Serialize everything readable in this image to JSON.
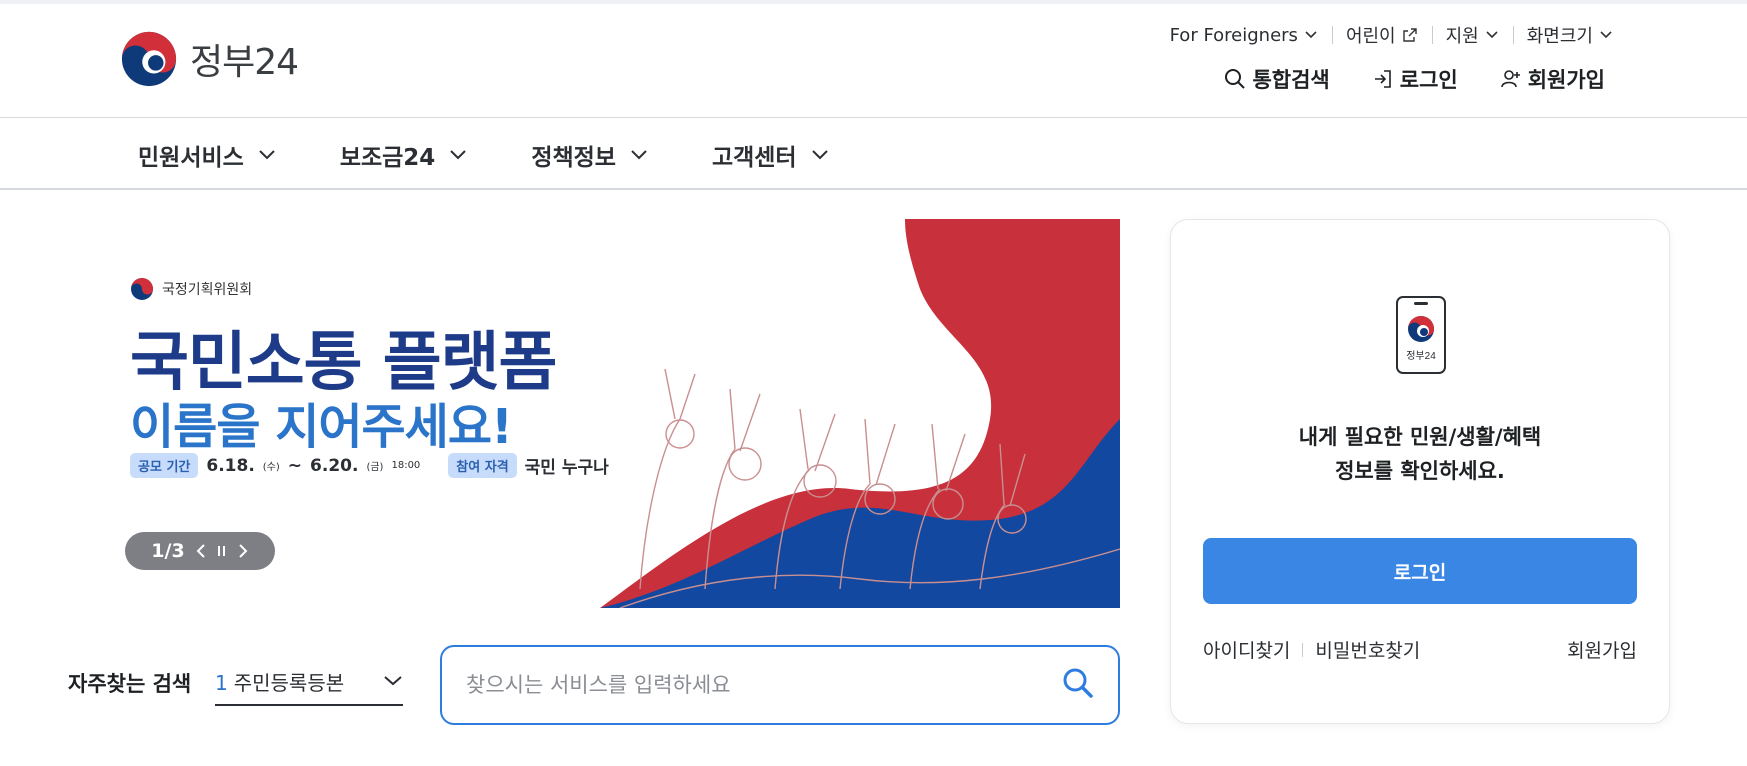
{
  "header": {
    "brand": "정부24",
    "utility": [
      "For Foreigners",
      "어린이",
      "지원",
      "화면크기"
    ],
    "actions": {
      "search": "통합검색",
      "login": "로그인",
      "signup": "회원가입"
    }
  },
  "nav": [
    "민원서비스",
    "보조금24",
    "정책정보",
    "고객센터"
  ],
  "banner": {
    "org": "국정기획위원회",
    "title1": "국민소통 플랫폼",
    "title2": "이름을 지어주세요!",
    "period_label": "공모 기간",
    "start": "6.18.",
    "start_day": "(수)",
    "tilde": "~",
    "end": "6.20.",
    "end_day": "(금)",
    "end_time": "18:00",
    "eligibility_label": "참여 자격",
    "eligibility": "국민 누구나",
    "slide_indicator": "1/3"
  },
  "search": {
    "fav_label": "자주찾는 검색",
    "fav_index": "1",
    "fav_value": "주민등록등본",
    "placeholder": "찾으시는 서비스를 입력하세요"
  },
  "panel": {
    "app_name": "정부24",
    "message1": "내게 필요한 민원/생활/혜택",
    "message2": "정보를 확인하세요.",
    "login": "로그인",
    "find_id": "아이디찾기",
    "find_pw": "비밀번호찾기",
    "signup": "회원가입"
  },
  "colors": {
    "primary": "#3a86e5",
    "navy": "#1d3b88",
    "red": "#c8303c",
    "blue": "#2a74c9"
  }
}
